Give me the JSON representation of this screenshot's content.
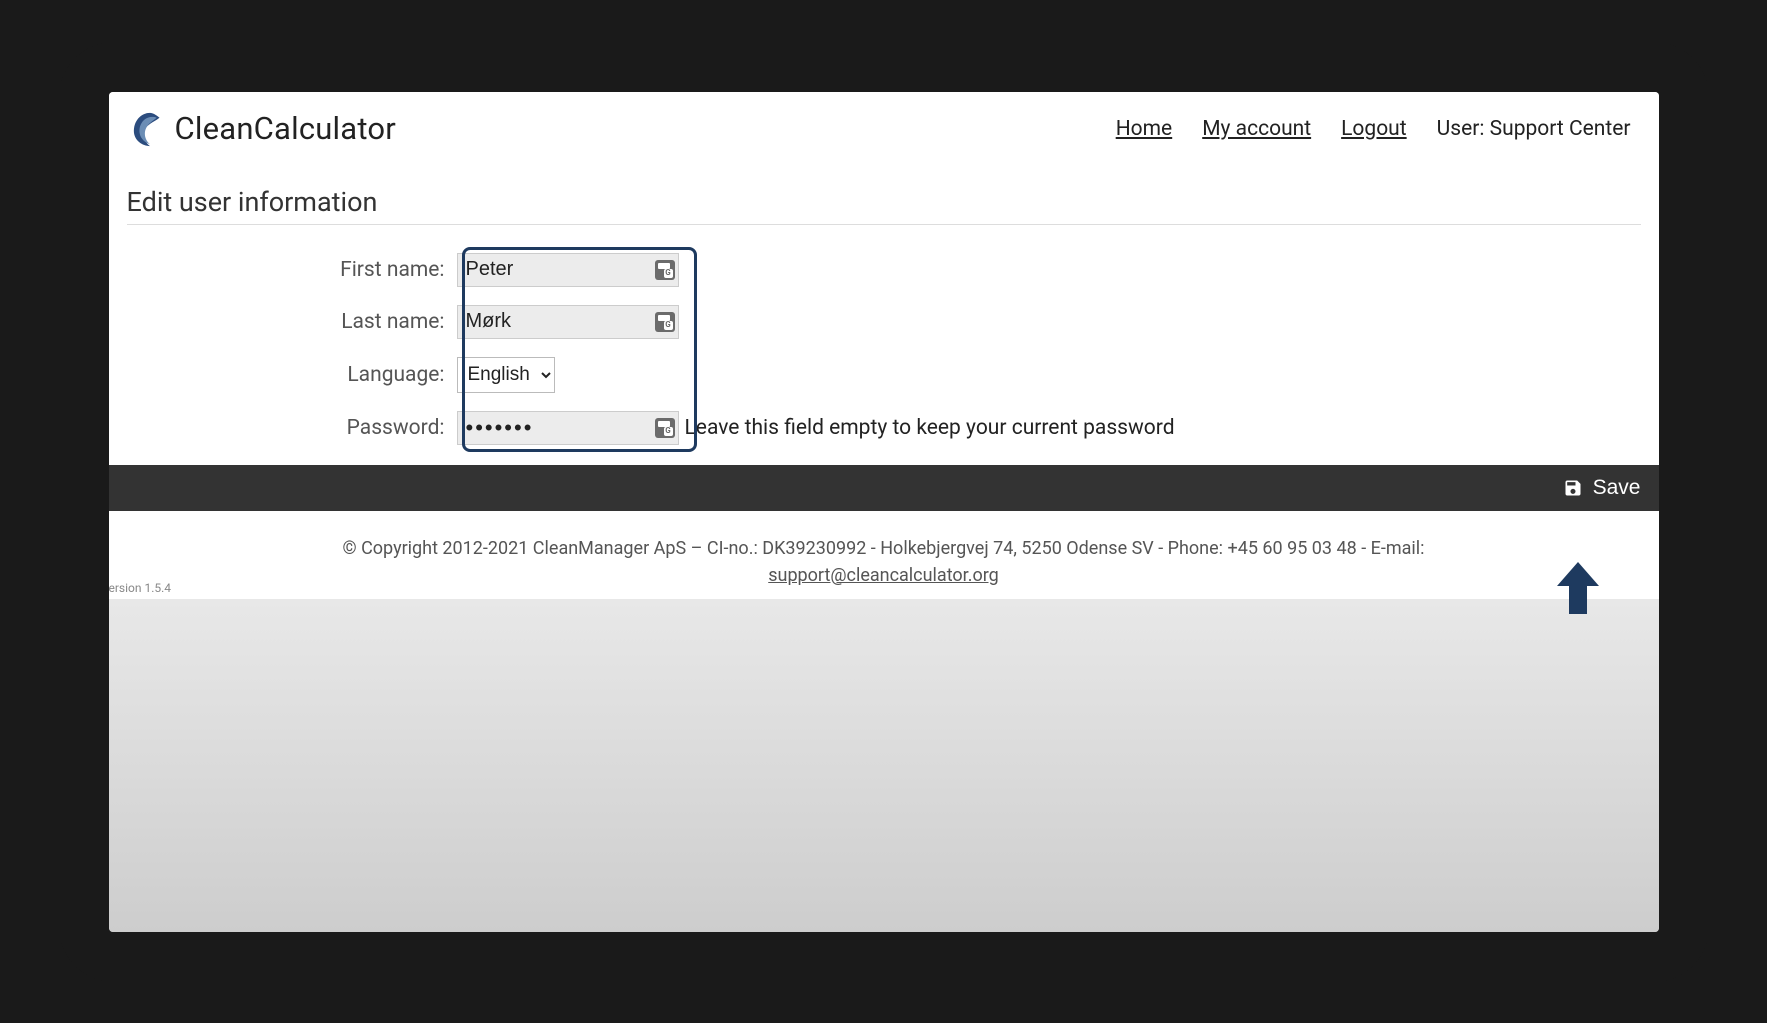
{
  "brand": {
    "name": "CleanCalculator"
  },
  "nav": {
    "home": "Home",
    "my_account": "My account",
    "logout": "Logout",
    "user_prefix": "User: ",
    "user_name": "Support Center"
  },
  "page": {
    "title": "Edit user information"
  },
  "form": {
    "first_name": {
      "label": "First name:",
      "value": "Peter"
    },
    "last_name": {
      "label": "Last name:",
      "value": "Mørk"
    },
    "language": {
      "label": "Language:",
      "selected": "English"
    },
    "password": {
      "label": "Password:",
      "value": "•••••••",
      "hint": "Leave this field empty to keep your current password"
    }
  },
  "actions": {
    "save": "Save"
  },
  "footer": {
    "copyright": "© Copyright 2012-2021 CleanManager ApS – CI-no.: DK39230992 - Holkebjergvej 74, 5250 Odense SV - Phone: +45 60 95 03 48 - E-mail: ",
    "email": "support@cleancalculator.org",
    "version": "ersion 1.5.4"
  }
}
